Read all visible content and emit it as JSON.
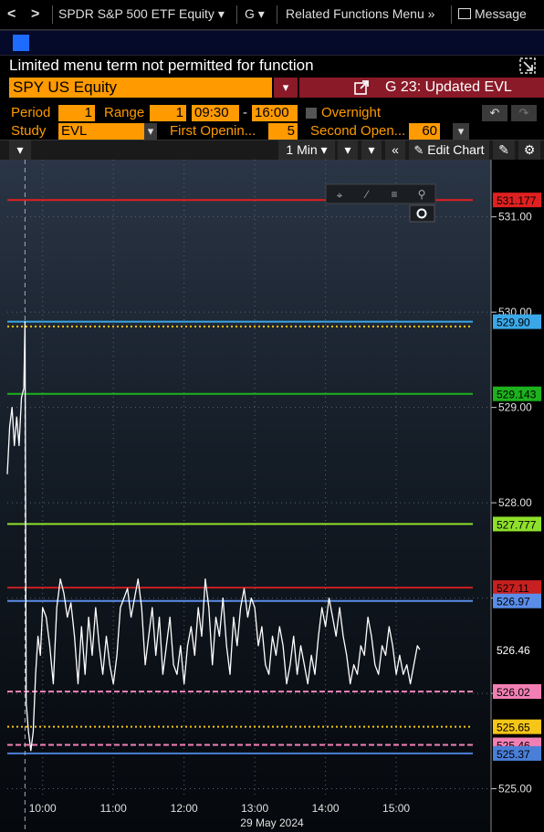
{
  "topbar": {
    "back": "<",
    "forward": ">",
    "security_menu": "SPDR S&P 500 ETF Equity ▾",
    "g_menu": "G ▾",
    "related": "Related Functions Menu »",
    "message": "Message"
  },
  "status_text": "Limited menu term not permitted for function",
  "security": {
    "value": "SPY US Equity",
    "dropdown": "▾"
  },
  "function": {
    "label": "G 23: Updated EVL"
  },
  "params": {
    "period_label": "Period",
    "period_value": "1",
    "range_label": "Range",
    "range_value": "1",
    "time_start": "09:30",
    "dash": "-",
    "time_end": "16:00",
    "overnight_label": "Overnight",
    "study_label": "Study",
    "study_value": "EVL",
    "first_label": "First Openin...",
    "first_value": "5",
    "second_label": "Second Open...",
    "second_value": "60"
  },
  "toolbar": {
    "interval": "1 Min",
    "edit_chart": "Edit Chart"
  },
  "colors": {
    "orange": "#ff9a00",
    "red": "#e02020",
    "blue": "#5aa0ff",
    "green": "#1db21d",
    "lime": "#8ee02a",
    "pink": "#f27fb4",
    "yellow": "#f5c518",
    "lightblue": "#3aa8e8"
  },
  "chart_data": {
    "type": "line",
    "title": "",
    "xlabel": "29 May 2024",
    "x_ticks": [
      "10:00",
      "11:00",
      "12:00",
      "13:00",
      "14:00",
      "15:00"
    ],
    "y_ticks": [
      "531.00",
      "530.00",
      "529.00",
      "528.00",
      "527.00",
      "526.00",
      "525.00"
    ],
    "ylim": [
      524.9,
      531.6
    ],
    "xlim_minutes": [
      570,
      965
    ],
    "grid": true,
    "hlines": [
      {
        "value": 531.177,
        "label": "531.177",
        "color": "#e02020",
        "style": "solid"
      },
      {
        "value": 529.9,
        "label": "529.90",
        "color": "#3aa8e8",
        "style": "solid"
      },
      {
        "value": 529.85,
        "label": "",
        "color": "#f5c518",
        "style": "dotted"
      },
      {
        "value": 529.143,
        "label": "529.143",
        "color": "#1db21d",
        "style": "solid"
      },
      {
        "value": 527.777,
        "label": "527.777",
        "color": "#8ee02a",
        "style": "solid"
      },
      {
        "value": 527.11,
        "label": "527.11",
        "color": "#c82020",
        "style": "solid"
      },
      {
        "value": 526.97,
        "label": "526.97",
        "color": "#5a8de8",
        "style": "solid"
      },
      {
        "value": 526.02,
        "label": "526.02",
        "color": "#f27fb4",
        "style": "dashed"
      },
      {
        "value": 525.65,
        "label": "525.65",
        "color": "#f5c518",
        "style": "dotted"
      },
      {
        "value": 525.46,
        "label": "525.46",
        "color": "#f27fb4",
        "style": "dashed"
      },
      {
        "value": 525.37,
        "label": "525.37",
        "color": "#4a7fd8",
        "style": "solid"
      }
    ],
    "last_price": {
      "value": 526.46,
      "label": "526.46"
    },
    "vertical_marker_minute": 585,
    "series": [
      {
        "x": [
          570,
          572,
          574,
          576,
          578,
          580,
          582,
          584,
          585,
          586,
          588,
          590,
          592,
          594,
          596,
          598,
          600,
          603,
          606,
          609,
          612,
          615,
          618,
          621,
          624,
          627,
          630,
          633,
          636,
          639,
          642,
          645,
          648,
          651,
          654,
          657,
          660,
          663,
          666,
          669,
          672,
          675,
          678,
          681,
          684,
          687,
          690,
          693,
          696,
          699,
          702,
          705,
          708,
          711,
          714,
          717,
          720,
          723,
          726,
          729,
          732,
          735,
          738,
          741,
          744,
          747,
          750,
          753,
          756,
          759,
          762,
          765,
          768,
          771,
          774,
          777,
          780,
          783,
          786,
          789,
          792,
          795,
          798,
          801,
          804,
          807,
          810,
          813,
          816,
          819,
          822,
          825,
          828,
          831,
          834,
          837,
          840,
          843,
          846,
          849,
          852,
          855,
          858,
          861,
          864,
          867,
          870,
          873,
          876,
          879,
          882,
          885,
          888,
          891,
          894,
          897,
          900,
          903,
          906,
          909,
          912,
          915,
          918,
          920
        ],
        "y": [
          528.3,
          528.8,
          529.0,
          528.6,
          528.9,
          528.6,
          529.1,
          529.2,
          529.9,
          525.9,
          525.6,
          525.4,
          525.6,
          526.2,
          526.6,
          526.4,
          526.9,
          526.8,
          526.5,
          526.1,
          526.9,
          527.2,
          527.05,
          526.8,
          526.95,
          526.6,
          526.1,
          526.7,
          526.2,
          526.8,
          526.4,
          526.9,
          526.5,
          526.2,
          526.6,
          526.3,
          526.1,
          526.4,
          526.9,
          527.0,
          527.1,
          526.8,
          527.0,
          527.2,
          526.9,
          526.3,
          526.6,
          526.9,
          526.4,
          526.8,
          526.2,
          526.5,
          526.8,
          526.3,
          526.2,
          526.5,
          526.1,
          526.5,
          526.7,
          526.4,
          526.9,
          526.6,
          527.2,
          526.9,
          526.3,
          526.8,
          526.6,
          527.0,
          526.5,
          526.2,
          526.8,
          526.5,
          526.9,
          527.1,
          526.8,
          527.0,
          526.9,
          526.5,
          526.7,
          526.3,
          526.2,
          526.6,
          526.4,
          526.7,
          526.5,
          526.1,
          526.3,
          526.6,
          526.2,
          526.5,
          526.3,
          526.1,
          526.4,
          526.2,
          526.6,
          526.9,
          526.7,
          527.0,
          526.8,
          526.6,
          526.9,
          526.6,
          526.4,
          526.1,
          526.3,
          526.2,
          526.5,
          526.4,
          526.8,
          526.6,
          526.3,
          526.2,
          526.5,
          526.4,
          526.7,
          526.5,
          526.2,
          526.4,
          526.2,
          526.3,
          526.1,
          526.3,
          526.5,
          526.46
        ]
      }
    ]
  }
}
